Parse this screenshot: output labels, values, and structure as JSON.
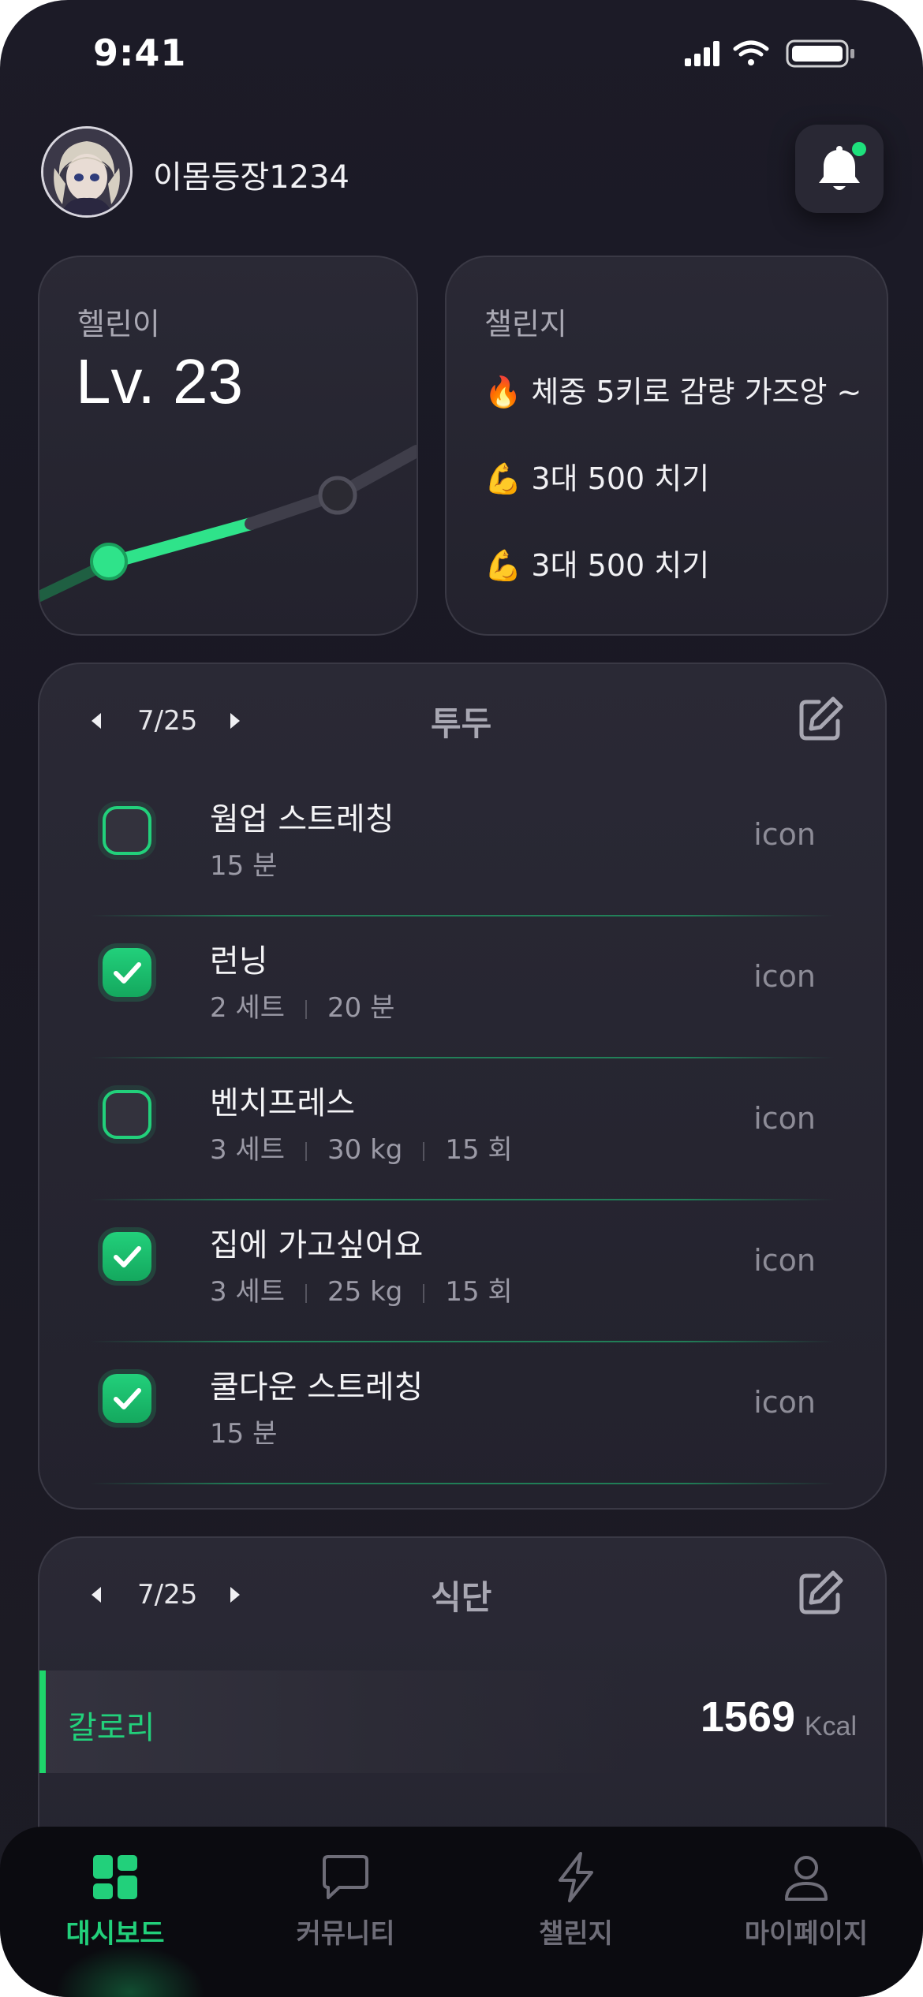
{
  "status_bar": {
    "time": "9:41"
  },
  "header": {
    "username": "이몸등장1234"
  },
  "level_card": {
    "label": "헬린이",
    "value": "Lv. 23"
  },
  "challenge_card": {
    "label": "챌린지",
    "items": [
      {
        "emoji": "🔥",
        "text": "체중 5키로 감량 가즈앙 ~"
      },
      {
        "emoji": "💪",
        "text": "3대 500 치기"
      },
      {
        "emoji": "💪",
        "text": "3대 500 치기"
      }
    ]
  },
  "todo": {
    "date": "7/25",
    "title": "투두",
    "items": [
      {
        "title": "웜업 스트레칭",
        "meta": [
          "15 분"
        ],
        "checked": false,
        "icon": "icon"
      },
      {
        "title": "런닝",
        "meta": [
          "2 세트",
          "20 분"
        ],
        "checked": true,
        "icon": "icon"
      },
      {
        "title": "벤치프레스",
        "meta": [
          "3 세트",
          "30 kg",
          "15 회"
        ],
        "checked": false,
        "icon": "icon"
      },
      {
        "title": "집에 가고싶어요",
        "meta": [
          "3 세트",
          "25 kg",
          "15 회"
        ],
        "checked": true,
        "icon": "icon"
      },
      {
        "title": "쿨다운 스트레칭",
        "meta": [
          "15 분"
        ],
        "checked": true,
        "icon": "icon"
      }
    ]
  },
  "diet": {
    "date": "7/25",
    "title": "식단",
    "calorie_label": "칼로리",
    "calorie_value": "1569",
    "calorie_unit": "Kcal"
  },
  "bottom_nav": {
    "items": [
      {
        "label": "대시보드",
        "icon": "dashboard-icon",
        "active": true
      },
      {
        "label": "커뮤니티",
        "icon": "chat-bubble-icon",
        "active": false
      },
      {
        "label": "챌린지",
        "icon": "lightning-icon",
        "active": false
      },
      {
        "label": "마이페이지",
        "icon": "person-icon",
        "active": false
      }
    ]
  },
  "colors": {
    "accent": "#22d07b",
    "background": "#1c1b27",
    "card": "#2a2935",
    "nav_background": "#0b0b10",
    "inactive": "#6e6d78"
  }
}
